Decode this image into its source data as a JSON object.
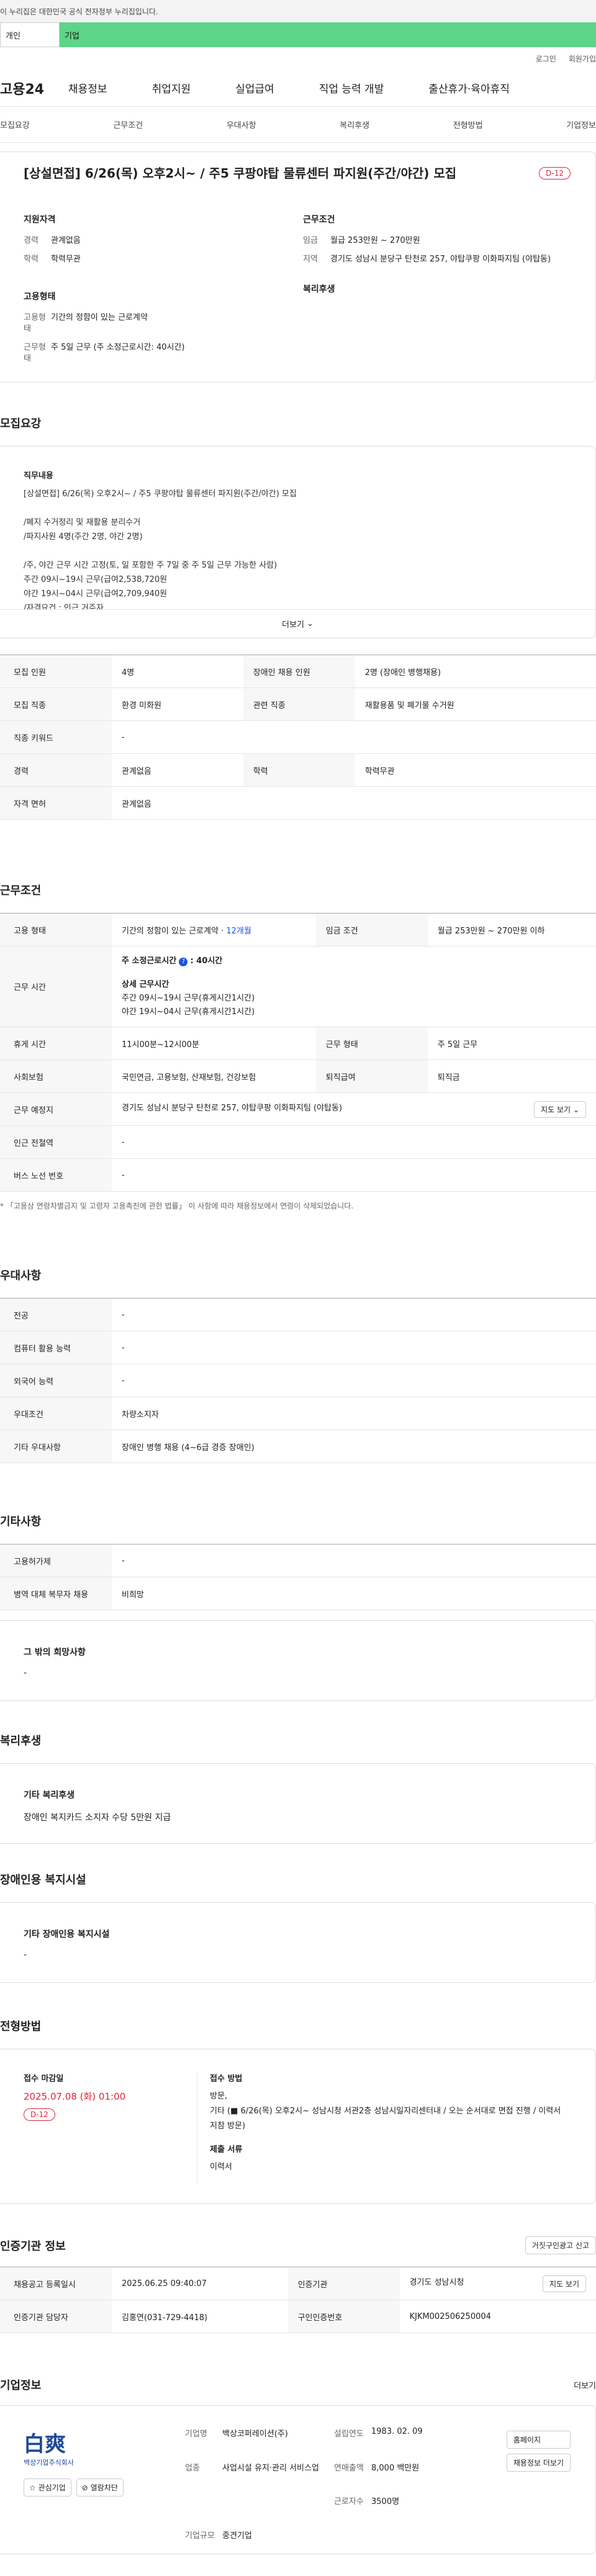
{
  "banner": {
    "text": "이 누리집은 대한민국 공식 전자정부 누리집입니다."
  },
  "top_tabs": {
    "personal": "개인",
    "company": "기업"
  },
  "util": {
    "login": "로그인",
    "join": "회원가입"
  },
  "gnb": {
    "logo": "고용24",
    "items": [
      "채용정보",
      "취업지원",
      "실업급여",
      "직업 능력 개발",
      "출산휴가·육아휴직"
    ]
  },
  "subnav": [
    "모집요강",
    "근무조건",
    "우대사항",
    "복리후생",
    "전형방법",
    "기업정보"
  ],
  "summary": {
    "title": "[상설면접] 6/26(목) 오후2시~ / 주5 쿠팡야탑 물류센터 파지원(주간/야간) 모집",
    "dday": "D-12",
    "left": {
      "title1": "지원자격",
      "career_k": "경력",
      "career_v": "관계없음",
      "edu_k": "학력",
      "edu_v": "학력무관",
      "title2": "고용형태",
      "type_k": "고용형태",
      "type_v": "기간의 정함이 있는 근로계약",
      "hours_k": "근무형태",
      "hours_v": "주 5일 근무 (주 소정근로시간: 40시간)"
    },
    "right": {
      "title1": "근무조건",
      "wage_k": "임금",
      "wage_v": "월급 253만원 ~ 270만원",
      "loc_k": "지역",
      "loc_v": "경기도 성남시 분당구 탄천로 257, 야탑쿠팡 이화파지팀 (야탑동)",
      "title2": "복리후생"
    }
  },
  "req": {
    "section": "모집요강",
    "job_title": "직무내용",
    "lines": [
      "[상설면접] 6/26(목) 오후2시~ / 주5 쿠팡야탑 물류센터 파지원(주간/야간) 모집",
      "",
      "/폐지 수거정리 및 재활용 분리수거",
      "/파지사원 4명(주간 2명, 야간 2명)",
      "",
      "/주, 야간 근무 시간 고정(토, 일 포함한 주 7일 중 주 5일 근무 가능한 사람)",
      "주간 09시~19시 근무(급여2,538,720원",
      "야간 19시~04시 근무(급여2,709,940원",
      "/자격요건 : 인근 거주자"
    ],
    "more": "더보기"
  },
  "req_table": [
    {
      "k1": "모집 인원",
      "v1": "4명",
      "k2": "장애인 채용 인원",
      "v2": "2명 (장애인 병행채용)"
    },
    {
      "k1": "모집 직종",
      "v1": "환경 미화원",
      "k2": "관련 직종",
      "v2": "재활용품 및 폐기물 수거원"
    },
    {
      "k1": "직종 키워드",
      "v1": "-"
    },
    {
      "k1": "경력",
      "v1": "관계없음",
      "k2": "학력",
      "v2": "학력무관"
    },
    {
      "k1": "자격 면허",
      "v1": "관계없음"
    }
  ],
  "cond": {
    "section": "근무조건",
    "type_k": "고용 형태",
    "type_v": "기간의 정함이 있는 근로계약 ·",
    "months": "12개월",
    "wage_k": "임금 조건",
    "wage_v": "월급 253만원 ~ 270만원 이하",
    "time_k": "근무 시간",
    "time_v1": "주 소정근로시간",
    "time_v1b": ": 40시간",
    "time_detail_t": "상세 근무시간",
    "time_detail1": "주간 09시~19시 근무(휴게시간1시간)",
    "time_detail2": "야간 19시~04시 근무(휴게시간1시간)",
    "break_k": "휴게 시간",
    "break_v": "11시00분~12시00분",
    "form_k": "근무 형태",
    "form_v": "주 5일 근무",
    "ins_k": "사회보험",
    "ins_v": "국민연금, 고용보험, 산재보험, 건강보험",
    "ret_k": "퇴직급여",
    "ret_v": "퇴직금",
    "place_k": "근무 예정지",
    "place_v": "경기도 성남시 분당구 탄천로 257, 야탑쿠팡 이화파지팀 (야탑동)",
    "map": "지도 보기",
    "sub_k": "인근 전철역",
    "sub_v": "-",
    "bus_k": "버스 노선 번호",
    "bus_v": "-",
    "note": "* 「고용상 연령차별금지 및 고령자 고용촉진에 관한 법률」 이 사항에 따라 채용정보에서 연령이 삭제되었습니다."
  },
  "pref": {
    "section": "우대사항",
    "rows": [
      [
        "전공",
        "-"
      ],
      [
        "컴퓨터 활용 능력",
        "-"
      ],
      [
        "외국어 능력",
        "-"
      ],
      [
        "우대조건",
        "차량소지자"
      ],
      [
        "기타 우대사항",
        "장애인 병행 채용 (4~6급 경증 장애인)"
      ]
    ]
  },
  "etc": {
    "section": "기타사항",
    "rows": [
      [
        "고용허가제",
        "-"
      ],
      [
        "병역 대체 복무자 채용",
        "비희망"
      ]
    ],
    "box_t": "그 밖의 희망사항",
    "box_v": "-"
  },
  "welfare": {
    "section": "복리후생",
    "box_t": "기타 복리후생",
    "box_v": "장애인 복지카드 소지자 수당 5만원 지급"
  },
  "disability": {
    "section": "장애인용 복지시설",
    "box_t": "기타 장애인용 복지시설",
    "box_v": "-"
  },
  "process": {
    "section": "전형방법",
    "deadline_t": "접수 마감일",
    "deadline": "2025.07.08 (화) 01:00",
    "dday": "D-12",
    "method_t": "접수 방법",
    "method1": "방문,",
    "method2": "기타 (■ 6/26(목) 오후2시~ 성남시청 서관2층 성남시일자리센터내 / 오는 순서대로 면접 진행 / 이력서 지참 방문)",
    "docs_t": "제출 서류",
    "docs_v": "이력서"
  },
  "cert": {
    "section": "인증기관 정보",
    "report": "거짓구인광고 신고",
    "reg_k": "채용공고 등록일시",
    "reg_v": "2025.06.25 09:40:07",
    "org_k": "인증기관",
    "org_v": "경기도 성남시청",
    "map": "지도 보기",
    "mgr_k": "인증기관 담당자",
    "mgr_v": "김홍연(031-729-4418)",
    "num_k": "구인인증번호",
    "num_v": "KJKM002506250004"
  },
  "company": {
    "section": "기업정보",
    "more": "더보기",
    "logo_mark": "白爽",
    "logo_sub": "백상기업주식회사",
    "fav": "관심기업",
    "block": "열람차단",
    "name_k": "기업명",
    "name_v": "백상코퍼레이션(주)",
    "est_k": "설립연도",
    "est_v": "1983. 02. 09",
    "biz_k": "업종",
    "biz_v": "사업시설 유지·관리 서비스업",
    "sales_k": "연매출액",
    "sales_v": "8,000 백만원",
    "emp_k": "근로자수",
    "emp_v": "3500명",
    "size_k": "기업규모",
    "size_v": "중견기업",
    "home": "홈페이지",
    "other_jobs": "채용정보 더보기"
  }
}
